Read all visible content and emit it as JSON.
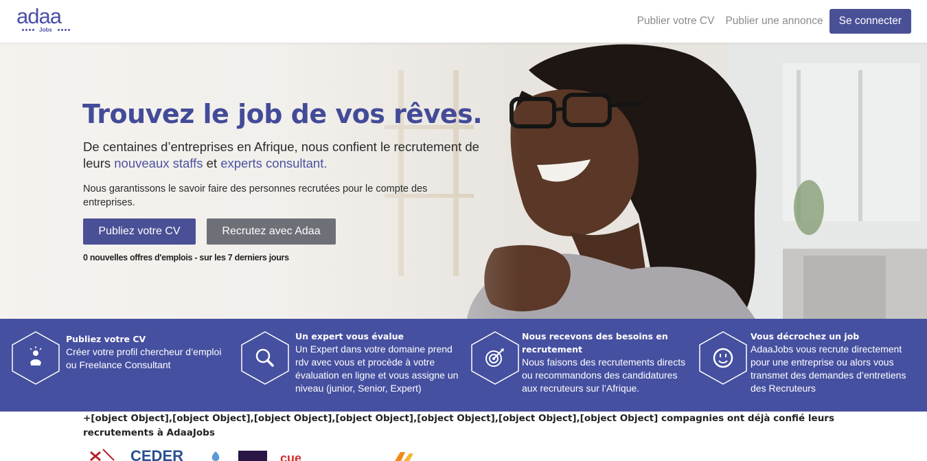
{
  "header": {
    "logo_text": "adaa",
    "logo_sub": "Jobs",
    "nav": [
      {
        "label": "Publier votre CV"
      },
      {
        "label": "Publier une annonce"
      }
    ],
    "login_label": "Se connecter"
  },
  "hero": {
    "title": "Trouvez le job de vos rêves.",
    "lead_part1": "De centaines d’entreprises en Afrique, nous confient le recrutement de leurs ",
    "lead_link1": "nouveaux staffs",
    "lead_part2": " et ",
    "lead_link2": "experts consultant.",
    "sub": "Nous garantissons le savoir faire des personnes recrutées pour le compte des entreprises.",
    "btn_cv": "Publiez votre CV",
    "btn_recruit": "Recrutez avec Adaa",
    "count_text": "0 nouvelles offres d'emplois - sur les 7 derniers jours"
  },
  "steps": [
    {
      "icon": "presenter-icon",
      "title": "Publiez votre CV",
      "text": "Créer votre profil chercheur d’emploi ou Freelance Consultant"
    },
    {
      "icon": "magnifier-icon",
      "title": "Un expert vous évalue",
      "text": "Un Expert dans votre domaine prend rdv avec vous et procède à votre évaluation en ligne et vous assigne un niveau (junior, Senior, Expert)"
    },
    {
      "icon": "target-icon",
      "title": "Nous recevons des besoins en recrutement",
      "text": "Nous faisons des recrutements directs ou recommandons des candidatures aux recruteurs sur l’Afrique."
    },
    {
      "icon": "smiley-icon",
      "title": "Vous décrochez un job",
      "text": "AdaaJobs vous recrute directement pour une entreprise ou alors vous transmet des demandes d’entretiens des Recruteurs"
    }
  ],
  "trust_text": "+[object Object],[object Object],[object Object],[object Object],[object Object],[object Object],[object Object] compagnies ont déjà confié leurs recrutements à AdaaJobs",
  "partner_logos": [
    "CEDER",
    "cue"
  ],
  "colors": {
    "brand": "#4a5096",
    "band": "#4650a0",
    "title": "#434b98",
    "grey_button": "#6e7078"
  }
}
